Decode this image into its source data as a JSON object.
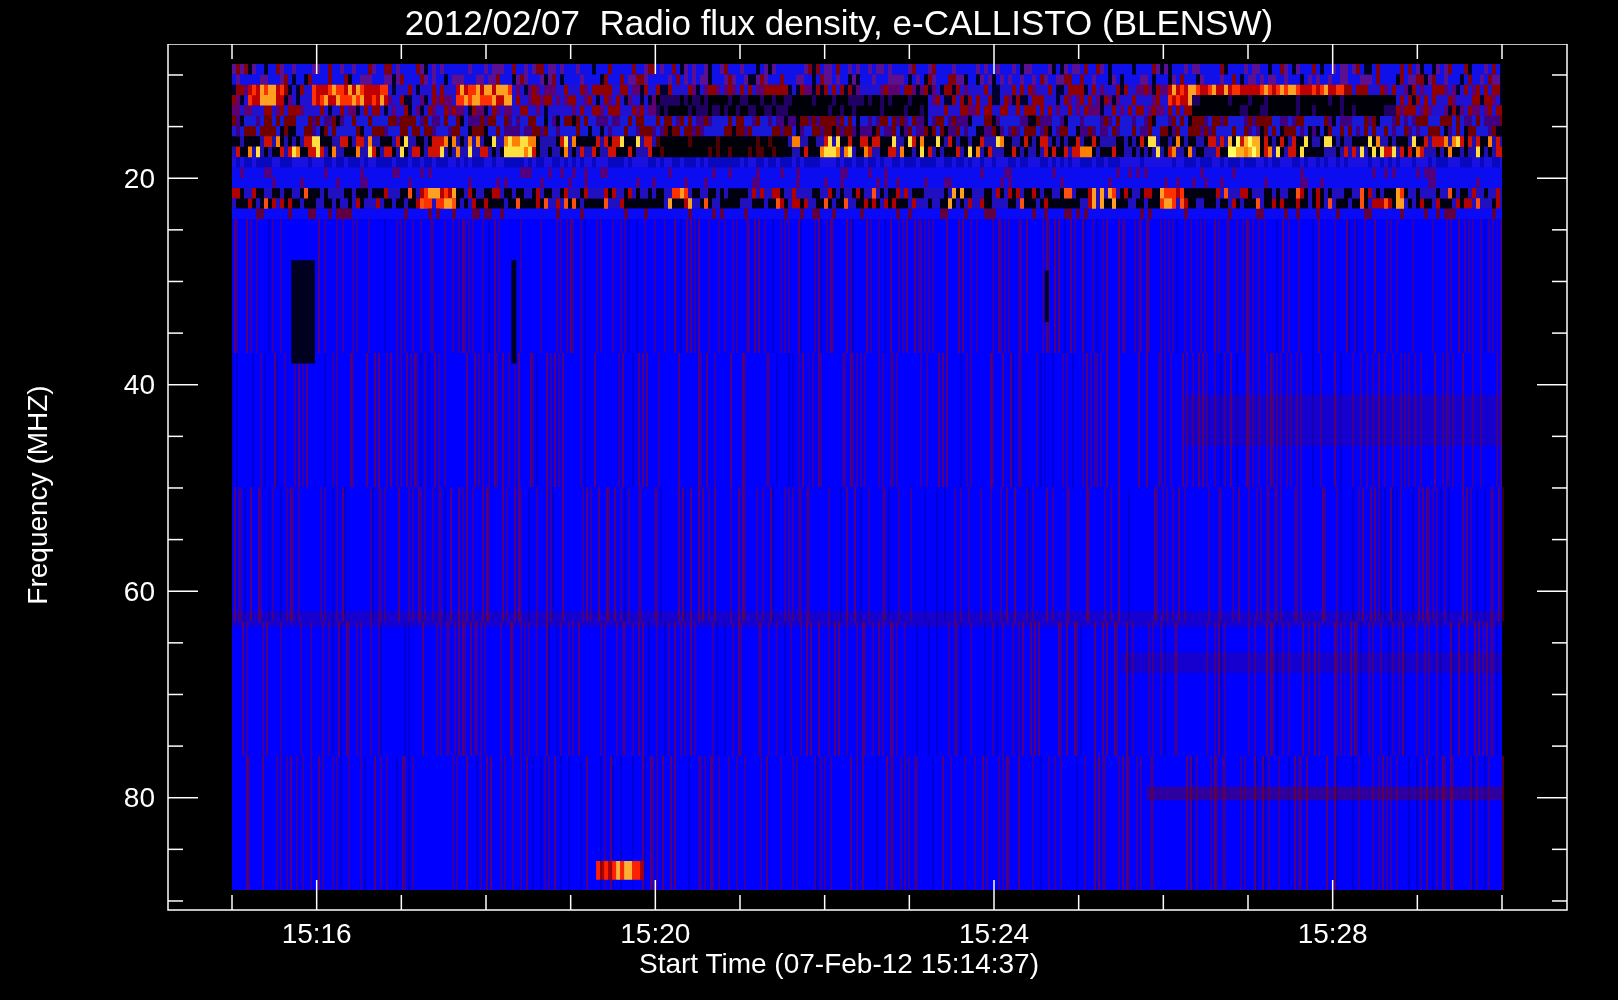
{
  "plot": {
    "title": "2012/02/07  Radio flux density, e-CALLISTO (BLENSW)",
    "ylabel": "Frequency (MHZ)",
    "xlabel": "Start Time (07-Feb-12 15:14:37)",
    "yticks": [
      "20",
      "40",
      "60",
      "80"
    ],
    "xticks": [
      "15:16",
      "15:20",
      "15:24",
      "15:28"
    ]
  }
}
